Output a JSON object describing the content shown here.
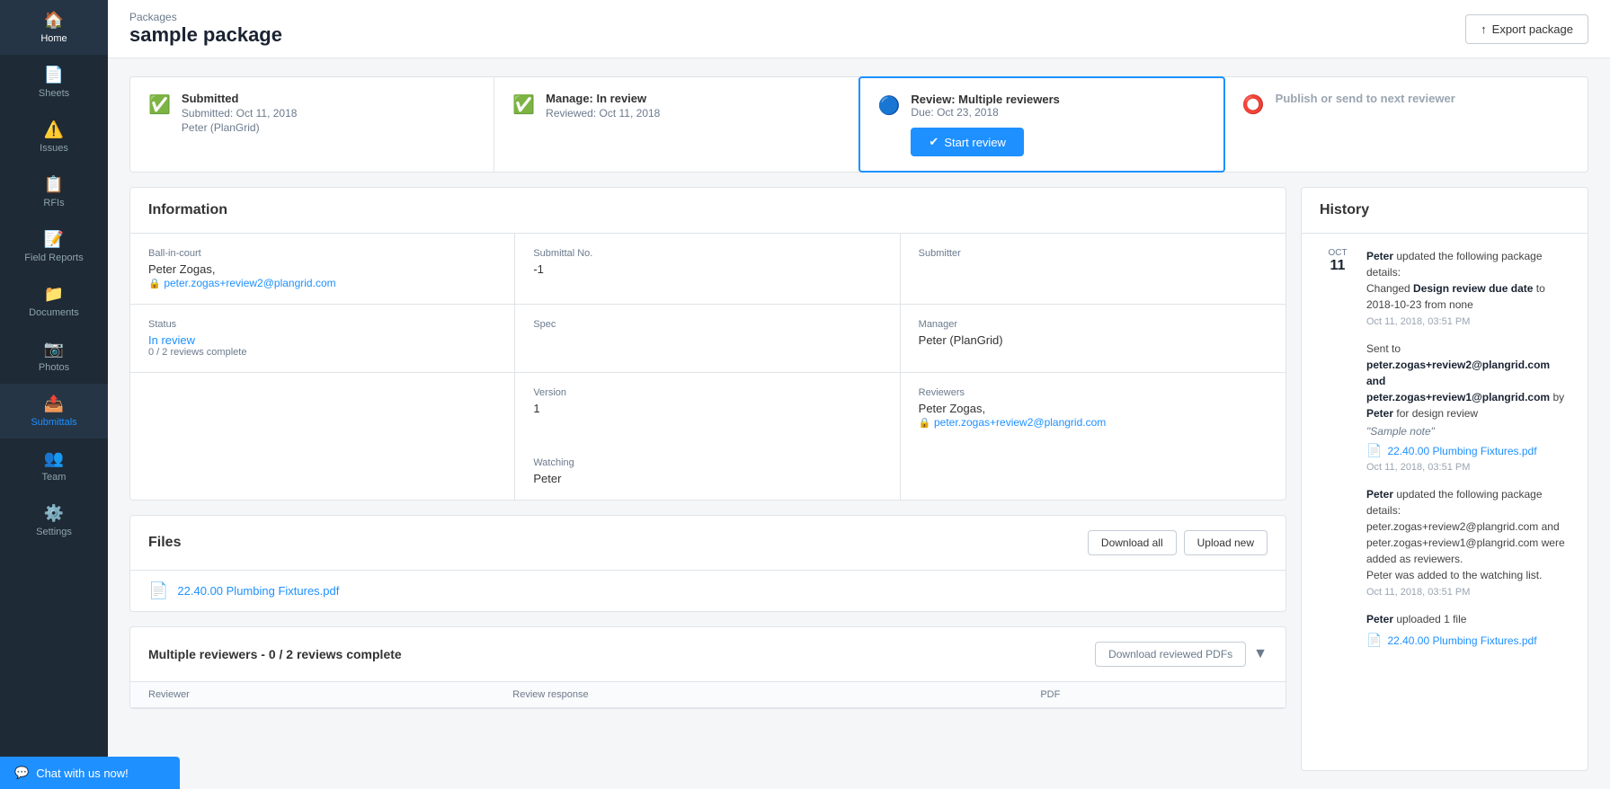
{
  "sidebar": {
    "items": [
      {
        "id": "home",
        "label": "Home",
        "icon": "🏠"
      },
      {
        "id": "sheets",
        "label": "Sheets",
        "icon": "📄"
      },
      {
        "id": "issues",
        "label": "Issues",
        "icon": "⚠️"
      },
      {
        "id": "rfis",
        "label": "RFIs",
        "icon": "📋"
      },
      {
        "id": "field-reports",
        "label": "Field Reports",
        "icon": "📝"
      },
      {
        "id": "documents",
        "label": "Documents",
        "icon": "📁"
      },
      {
        "id": "photos",
        "label": "Photos",
        "icon": "📷"
      },
      {
        "id": "submittals",
        "label": "Submittals",
        "icon": "📤",
        "active": true
      },
      {
        "id": "team",
        "label": "Team",
        "icon": "👥"
      },
      {
        "id": "settings",
        "label": "Settings",
        "icon": "⚙️"
      }
    ]
  },
  "header": {
    "breadcrumb": "Packages",
    "title": "sample package",
    "export_button": "Export package"
  },
  "workflow": {
    "steps": [
      {
        "id": "submitted",
        "title": "Submitted",
        "sub1": "Submitted: Oct 11, 2018",
        "sub2": "Peter (PlanGrid)",
        "status": "done"
      },
      {
        "id": "manage",
        "title": "Manage: In review",
        "sub1": "Reviewed: Oct 11, 2018",
        "status": "done"
      },
      {
        "id": "review",
        "title": "Review: Multiple reviewers",
        "due": "Due: Oct 23, 2018",
        "button": "Start review",
        "status": "active"
      },
      {
        "id": "publish",
        "title": "Publish or send to next reviewer",
        "status": "inactive"
      }
    ]
  },
  "information": {
    "title": "Information",
    "fields": {
      "ball_in_court_label": "Ball-in-court",
      "ball_in_court_name": "Peter Zogas,",
      "ball_in_court_email": "peter.zogas+review2@plangrid.com",
      "status_label": "Status",
      "status_value": "In review",
      "reviews_complete": "0 / 2 reviews complete",
      "submittal_no_label": "Submittal No.",
      "submittal_no_value": "-1",
      "spec_label": "Spec",
      "spec_value": "",
      "version_label": "Version",
      "version_value": "1",
      "watching_label": "Watching",
      "watching_value": "Peter",
      "submitter_label": "Submitter",
      "submitter_value": "",
      "manager_label": "Manager",
      "manager_value": "Peter (PlanGrid)",
      "reviewers_label": "Reviewers",
      "reviewers_value": "Peter Zogas,",
      "reviewers_email": "peter.zogas+review2@plangrid.com"
    }
  },
  "files": {
    "title": "Files",
    "download_all": "Download all",
    "upload_new": "Upload new",
    "file_name": "22.40.00 Plumbing Fixtures.pdf"
  },
  "reviewers_section": {
    "title": "Multiple reviewers - 0 / 2 reviews complete",
    "download_btn": "Download reviewed PDFs",
    "columns": [
      "Reviewer",
      "Review response",
      "PDF"
    ]
  },
  "history": {
    "title": "History",
    "entries": [
      {
        "month": "OCT",
        "day": "11",
        "events": [
          {
            "text_pre": "",
            "actor": "Peter",
            "action": " updated the following package details:",
            "detail": "Changed ",
            "detail_bold": "Design review due date",
            "detail_post": " to 2018-10-23 from none",
            "timestamp": "Oct 11, 2018, 03:51 PM"
          },
          {
            "actor": "Sent to",
            "sent_emails": "peter.zogas+review2@plangrid.com and peter.zogas+review1@plangrid.com",
            "sent_by": " by ",
            "sent_actor": "Peter",
            "sent_reason": " for design review",
            "note": "\"Sample note\"",
            "file_name": "22.40.00 Plumbing Fixtures.pdf",
            "timestamp": "Oct 11, 2018, 03:51 PM"
          },
          {
            "actor": "Peter",
            "action": " updated the following package details:",
            "detail1": "peter.zogas+review2@plangrid.com and peter.zogas+review1@plangrid.com were added as reviewers.",
            "detail2": "Peter was added to the watching list.",
            "timestamp": "Oct 11, 2018, 03:51 PM"
          },
          {
            "actor": "Peter",
            "action": " uploaded 1 file",
            "file_name": "22.40.00 Plumbing Fixtures.pdf",
            "timestamp": ""
          }
        ]
      }
    ]
  },
  "chat": {
    "label": "Chat with us now!"
  }
}
